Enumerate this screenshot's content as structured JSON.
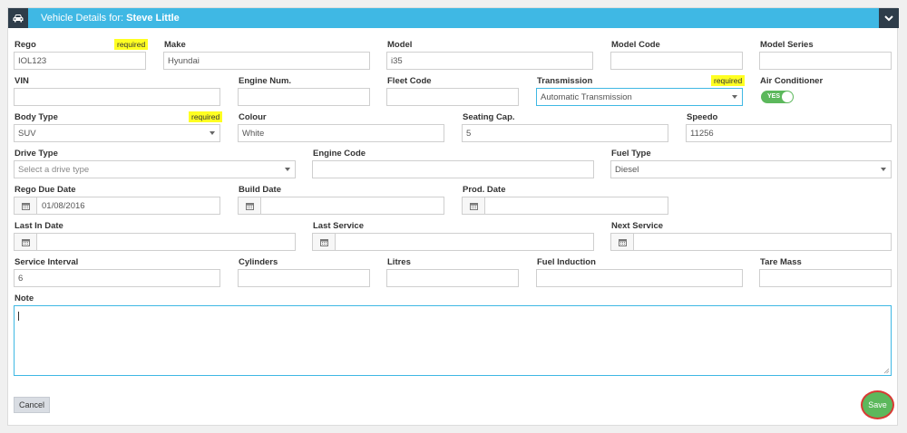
{
  "header": {
    "title_prefix": "Vehicle Details for:",
    "owner_name": "Steve Little",
    "car_icon": "car-icon",
    "collapse_icon": "chevron-down-icon",
    "bg_color": "#3fb8e4",
    "dark_color": "#2e3d4a"
  },
  "required_label": "required",
  "fields": {
    "rego": {
      "label": "Rego",
      "value": "IOL123"
    },
    "make": {
      "label": "Make",
      "value": "Hyundai"
    },
    "model": {
      "label": "Model",
      "value": "i35"
    },
    "model_code": {
      "label": "Model Code",
      "value": ""
    },
    "model_series": {
      "label": "Model Series",
      "value": ""
    },
    "vin": {
      "label": "VIN",
      "value": ""
    },
    "engine_num": {
      "label": "Engine Num.",
      "value": ""
    },
    "fleet_code": {
      "label": "Fleet Code",
      "value": ""
    },
    "transmission": {
      "label": "Transmission",
      "value": "Automatic Transmission"
    },
    "air_conditioner": {
      "label": "Air Conditioner",
      "toggle_text": "YES",
      "on": true
    },
    "body_type": {
      "label": "Body Type",
      "value": "SUV"
    },
    "colour": {
      "label": "Colour",
      "value": "White"
    },
    "seating_cap": {
      "label": "Seating Cap.",
      "value": "5"
    },
    "speedo": {
      "label": "Speedo",
      "value": "11256"
    },
    "drive_type": {
      "label": "Drive Type",
      "placeholder": "Select a drive type"
    },
    "engine_code": {
      "label": "Engine Code",
      "value": ""
    },
    "fuel_type": {
      "label": "Fuel Type",
      "value": "Diesel"
    },
    "rego_due_date": {
      "label": "Rego Due Date",
      "value": "01/08/2016"
    },
    "build_date": {
      "label": "Build Date",
      "value": ""
    },
    "prod_date": {
      "label": "Prod. Date",
      "value": ""
    },
    "last_in_date": {
      "label": "Last In Date",
      "value": ""
    },
    "last_service": {
      "label": "Last Service",
      "value": ""
    },
    "next_service": {
      "label": "Next Service",
      "value": ""
    },
    "service_interval": {
      "label": "Service Interval",
      "value": "6"
    },
    "cylinders": {
      "label": "Cylinders",
      "value": ""
    },
    "litres": {
      "label": "Litres",
      "value": ""
    },
    "fuel_induction": {
      "label": "Fuel Induction",
      "value": ""
    },
    "tare_mass": {
      "label": "Tare Mass",
      "value": ""
    },
    "note": {
      "label": "Note",
      "value": ""
    }
  },
  "buttons": {
    "cancel": "Cancel",
    "save": "Save"
  },
  "colors": {
    "save": "#5cb85c",
    "save_highlight": "#d83a34",
    "required_bg": "#ffff22",
    "focus": "#3fb8e4"
  }
}
